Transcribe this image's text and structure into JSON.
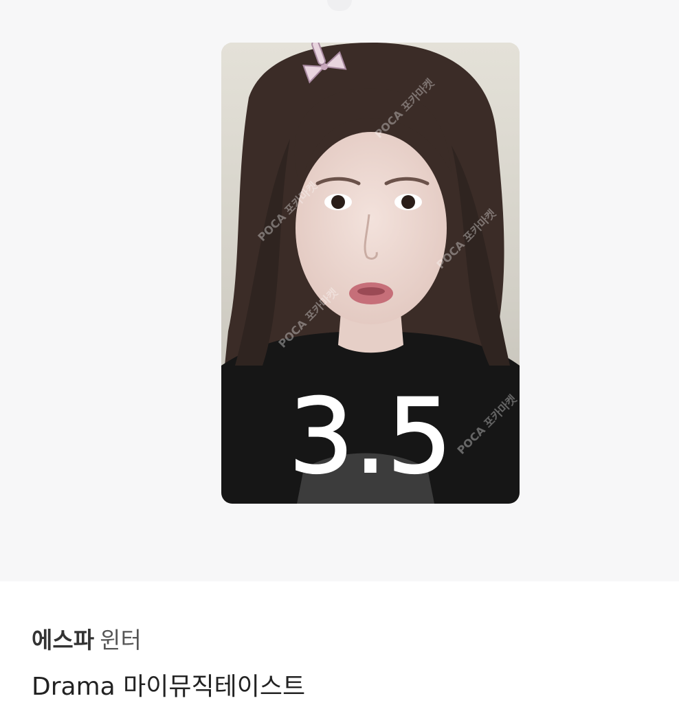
{
  "photocard": {
    "overlay_text": "3.5",
    "watermark_text": "POCA 포카마켓",
    "image_description_icon": "photo-image"
  },
  "item": {
    "group": "에스파",
    "member": "윈터",
    "title": "Drama 마이뮤직테이스트"
  },
  "colors": {
    "page_bg": "#f7f7f8",
    "info_bg": "#ffffff",
    "title_text": "#222222"
  }
}
